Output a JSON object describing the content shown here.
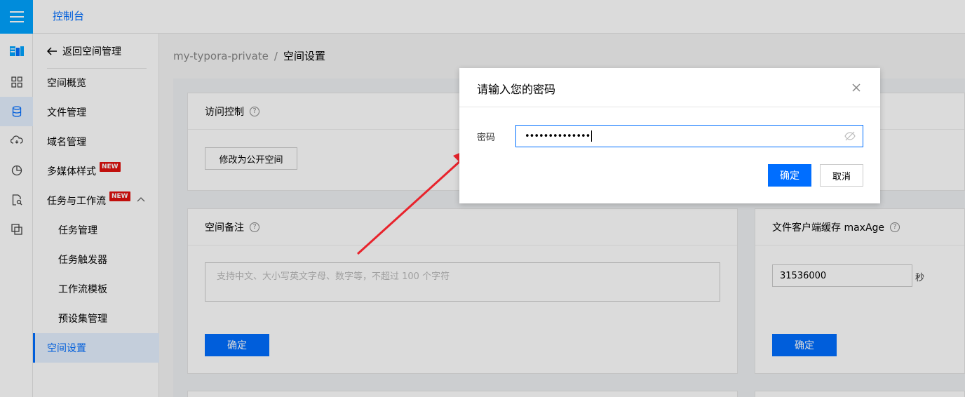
{
  "header": {
    "app_title": "控制台"
  },
  "nav": {
    "back_label": "返回空间管理",
    "items": [
      {
        "label": "空间概览"
      },
      {
        "label": "文件管理"
      },
      {
        "label": "域名管理"
      },
      {
        "label": "多媒体样式",
        "badge": "NEW"
      },
      {
        "label": "任务与工作流",
        "badge": "NEW"
      },
      {
        "label": "任务管理"
      },
      {
        "label": "任务触发器"
      },
      {
        "label": "工作流模板"
      },
      {
        "label": "预设集管理"
      },
      {
        "label": "空间设置"
      }
    ]
  },
  "breadcrumb": {
    "bucket": "my-typora-private",
    "separator": "/",
    "current": "空间设置"
  },
  "access_card": {
    "title": "访问控制",
    "help": "?",
    "button": "修改为公开空间"
  },
  "remark_card": {
    "title": "空间备注",
    "help": "?",
    "placeholder": "支持中文、大小写英文字母、数字等，不超过 100 个字符",
    "confirm": "确定"
  },
  "cache_card": {
    "title": "文件客户端缓存 maxAge",
    "help": "?",
    "value": "31536000",
    "unit": "秒",
    "confirm": "确定"
  },
  "dialog": {
    "title": "请输入您的密码",
    "label": "密码",
    "password_mask": "••••••••••••••",
    "ok": "确定",
    "cancel": "取消"
  },
  "colors": {
    "primary": "#006eff",
    "brand": "#00a4ff",
    "badge": "#e1120e",
    "arrow": "#e8232c"
  }
}
